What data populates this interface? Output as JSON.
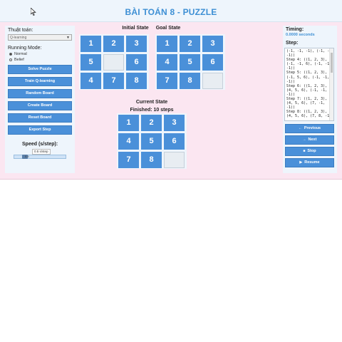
{
  "title": "BÀI TOÁN 8 - PUZZLE",
  "left": {
    "algo_label": "Thuật toán:",
    "algo_value": "Q-learning",
    "mode_label": "Running Mode:",
    "modes": [
      "Normal",
      "Belief"
    ],
    "selected_mode": "Normal",
    "buttons": [
      "Solve Puzzle",
      "Train Q-learning",
      "Random Board",
      "Create Board",
      "Reset Board",
      "Export Step"
    ],
    "speed_label": "Speed (s/step):",
    "speed_tooltip": "0.5 s/step",
    "speed_value": "0.5"
  },
  "initial": {
    "label": "Initial State",
    "tiles": [
      "1",
      "2",
      "3",
      "5",
      "",
      "6",
      "4",
      "7",
      "8"
    ]
  },
  "goal": {
    "label": "Goal State",
    "tiles": [
      "1",
      "2",
      "3",
      "4",
      "5",
      "6",
      "7",
      "8",
      ""
    ]
  },
  "current": {
    "label": "Current State",
    "status": "Finished: 10 steps",
    "tiles": [
      "1",
      "2",
      "3",
      "4",
      "5",
      "6",
      "7",
      "8",
      ""
    ]
  },
  "right": {
    "timing_label": "Timing:",
    "timing_value": "0.0000 seconds",
    "step_label": "Step:",
    "steps_text": "(-1, -1, -1), (-1, -1,\n-1))\nStep 4: ((1, 2, 3),\n(-1, -1, 6), (-1, -1,\n-1))\nStep 5: ((1, 2, 3),\n(-1, 5, 6), (-1, -1,\n-1))\nStep 6: ((1, 2, 3),\n(4, 5, 6), (-1, -1,\n-1))\nStep 7: ((1, 2, 3),\n(4, 5, 6), (7, -1,\n-1))\nStep 8: ((1, 2, 3),\n(4, 5, 6), (7, 8, -1))",
    "buttons": [
      {
        "icon": "chevron-left-icon",
        "glyph": "←",
        "label": "Previous"
      },
      {
        "icon": "chevron-right-icon",
        "glyph": "→",
        "label": "Next"
      },
      {
        "icon": "stop-icon",
        "glyph": "■",
        "label": "Stop"
      },
      {
        "icon": "play-icon",
        "glyph": "▶",
        "label": "Resume"
      }
    ]
  },
  "colors": {
    "accent": "#4a90d9",
    "title": "#3d8fd4",
    "panel": "#eef5fc",
    "frame": "#fbe6f1"
  }
}
